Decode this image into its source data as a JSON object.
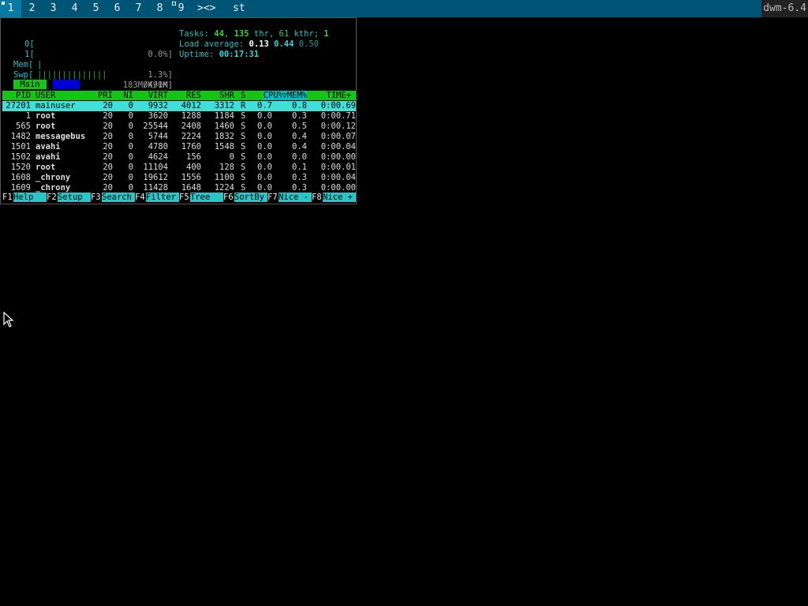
{
  "topbar": {
    "tags": [
      "1",
      "2",
      "3",
      "4",
      "5",
      "6",
      "7",
      "8",
      "9"
    ],
    "selected_tag": "1",
    "layout_symbol": "><>",
    "window_title": "st",
    "status": "dwm-6.4"
  },
  "htop": {
    "cpu0": {
      "label": "0[",
      "value": "0.0%]"
    },
    "cpu1": {
      "label": "1[",
      "value": "1.3%]"
    },
    "mem": {
      "label": "Mem[",
      "bars": "||||||||||||||",
      "value": "183M/491M]"
    },
    "swp": {
      "label": "Swp[",
      "value": "0K/0K]"
    },
    "tasks": {
      "label": "Tasks:",
      "count": "44",
      "thr": "135",
      "thr_label": "thr,",
      "kthr": "61",
      "kthr_label": "kthr;",
      "running": "1"
    },
    "load": {
      "label": "Load average:",
      "l1": "0.13",
      "l5": "0.44",
      "l15": "0.50"
    },
    "uptime": {
      "label": "Uptime:",
      "value": "00:17:31"
    },
    "tab_main": "Main",
    "columns": [
      "PID",
      "USER",
      "PRI",
      "NI",
      "VIRT",
      "RES",
      "SHR",
      "S",
      "CPU%",
      "▽MEM%",
      "TIME+"
    ],
    "processes": [
      {
        "pid": "27201",
        "user": "mainuser",
        "pri": "20",
        "ni": "0",
        "virt": "9932",
        "res": "4012",
        "shr": "3312",
        "s": "R",
        "cpu": "0.7",
        "mem": "0.8",
        "time": "0:00.69"
      },
      {
        "pid": "1",
        "user": "root",
        "pri": "20",
        "ni": "0",
        "virt": "3620",
        "res": "1288",
        "shr": "1184",
        "s": "S",
        "cpu": "0.0",
        "mem": "0.3",
        "time": "0:00.71"
      },
      {
        "pid": "565",
        "user": "root",
        "pri": "20",
        "ni": "0",
        "virt": "25544",
        "res": "2408",
        "shr": "1460",
        "s": "S",
        "cpu": "0.0",
        "mem": "0.5",
        "time": "0:00.12"
      },
      {
        "pid": "1482",
        "user": "messagebus",
        "pri": "20",
        "ni": "0",
        "virt": "5744",
        "res": "2224",
        "shr": "1832",
        "s": "S",
        "cpu": "0.0",
        "mem": "0.4",
        "time": "0:00.07"
      },
      {
        "pid": "1501",
        "user": "avahi",
        "pri": "20",
        "ni": "0",
        "virt": "4780",
        "res": "1760",
        "shr": "1548",
        "s": "S",
        "cpu": "0.0",
        "mem": "0.4",
        "time": "0:00.04"
      },
      {
        "pid": "1502",
        "user": "avahi",
        "pri": "20",
        "ni": "0",
        "virt": "4624",
        "res": "156",
        "shr": "0",
        "s": "S",
        "cpu": "0.0",
        "mem": "0.0",
        "time": "0:00.00"
      },
      {
        "pid": "1520",
        "user": "root",
        "pri": "20",
        "ni": "0",
        "virt": "11104",
        "res": "400",
        "shr": "128",
        "s": "S",
        "cpu": "0.0",
        "mem": "0.1",
        "time": "0:00.01"
      },
      {
        "pid": "1608",
        "user": "_chrony",
        "pri": "20",
        "ni": "0",
        "virt": "19612",
        "res": "1556",
        "shr": "1100",
        "s": "S",
        "cpu": "0.0",
        "mem": "0.3",
        "time": "0:00.04"
      },
      {
        "pid": "1609",
        "user": "_chrony",
        "pri": "20",
        "ni": "0",
        "virt": "11428",
        "res": "1648",
        "shr": "1224",
        "s": "S",
        "cpu": "0.0",
        "mem": "0.3",
        "time": "0:00.00"
      }
    ],
    "fkeys": [
      {
        "key": "F1",
        "label": "Help  "
      },
      {
        "key": "F2",
        "label": "Setup "
      },
      {
        "key": "F3",
        "label": "Search"
      },
      {
        "key": "F4",
        "label": "Filter"
      },
      {
        "key": "F5",
        "label": "Tree  "
      },
      {
        "key": "F6",
        "label": "SortBy"
      },
      {
        "key": "F7",
        "label": "Nice -"
      },
      {
        "key": "F8",
        "label": "Nice +"
      }
    ]
  },
  "colors": {
    "bar_bg": "#005577",
    "selected_tag_bg": "#0b7aa3",
    "header_green": "#15c515",
    "selected_row": "#40e0d8",
    "fkey_label_bg": "#2cc4c4"
  }
}
